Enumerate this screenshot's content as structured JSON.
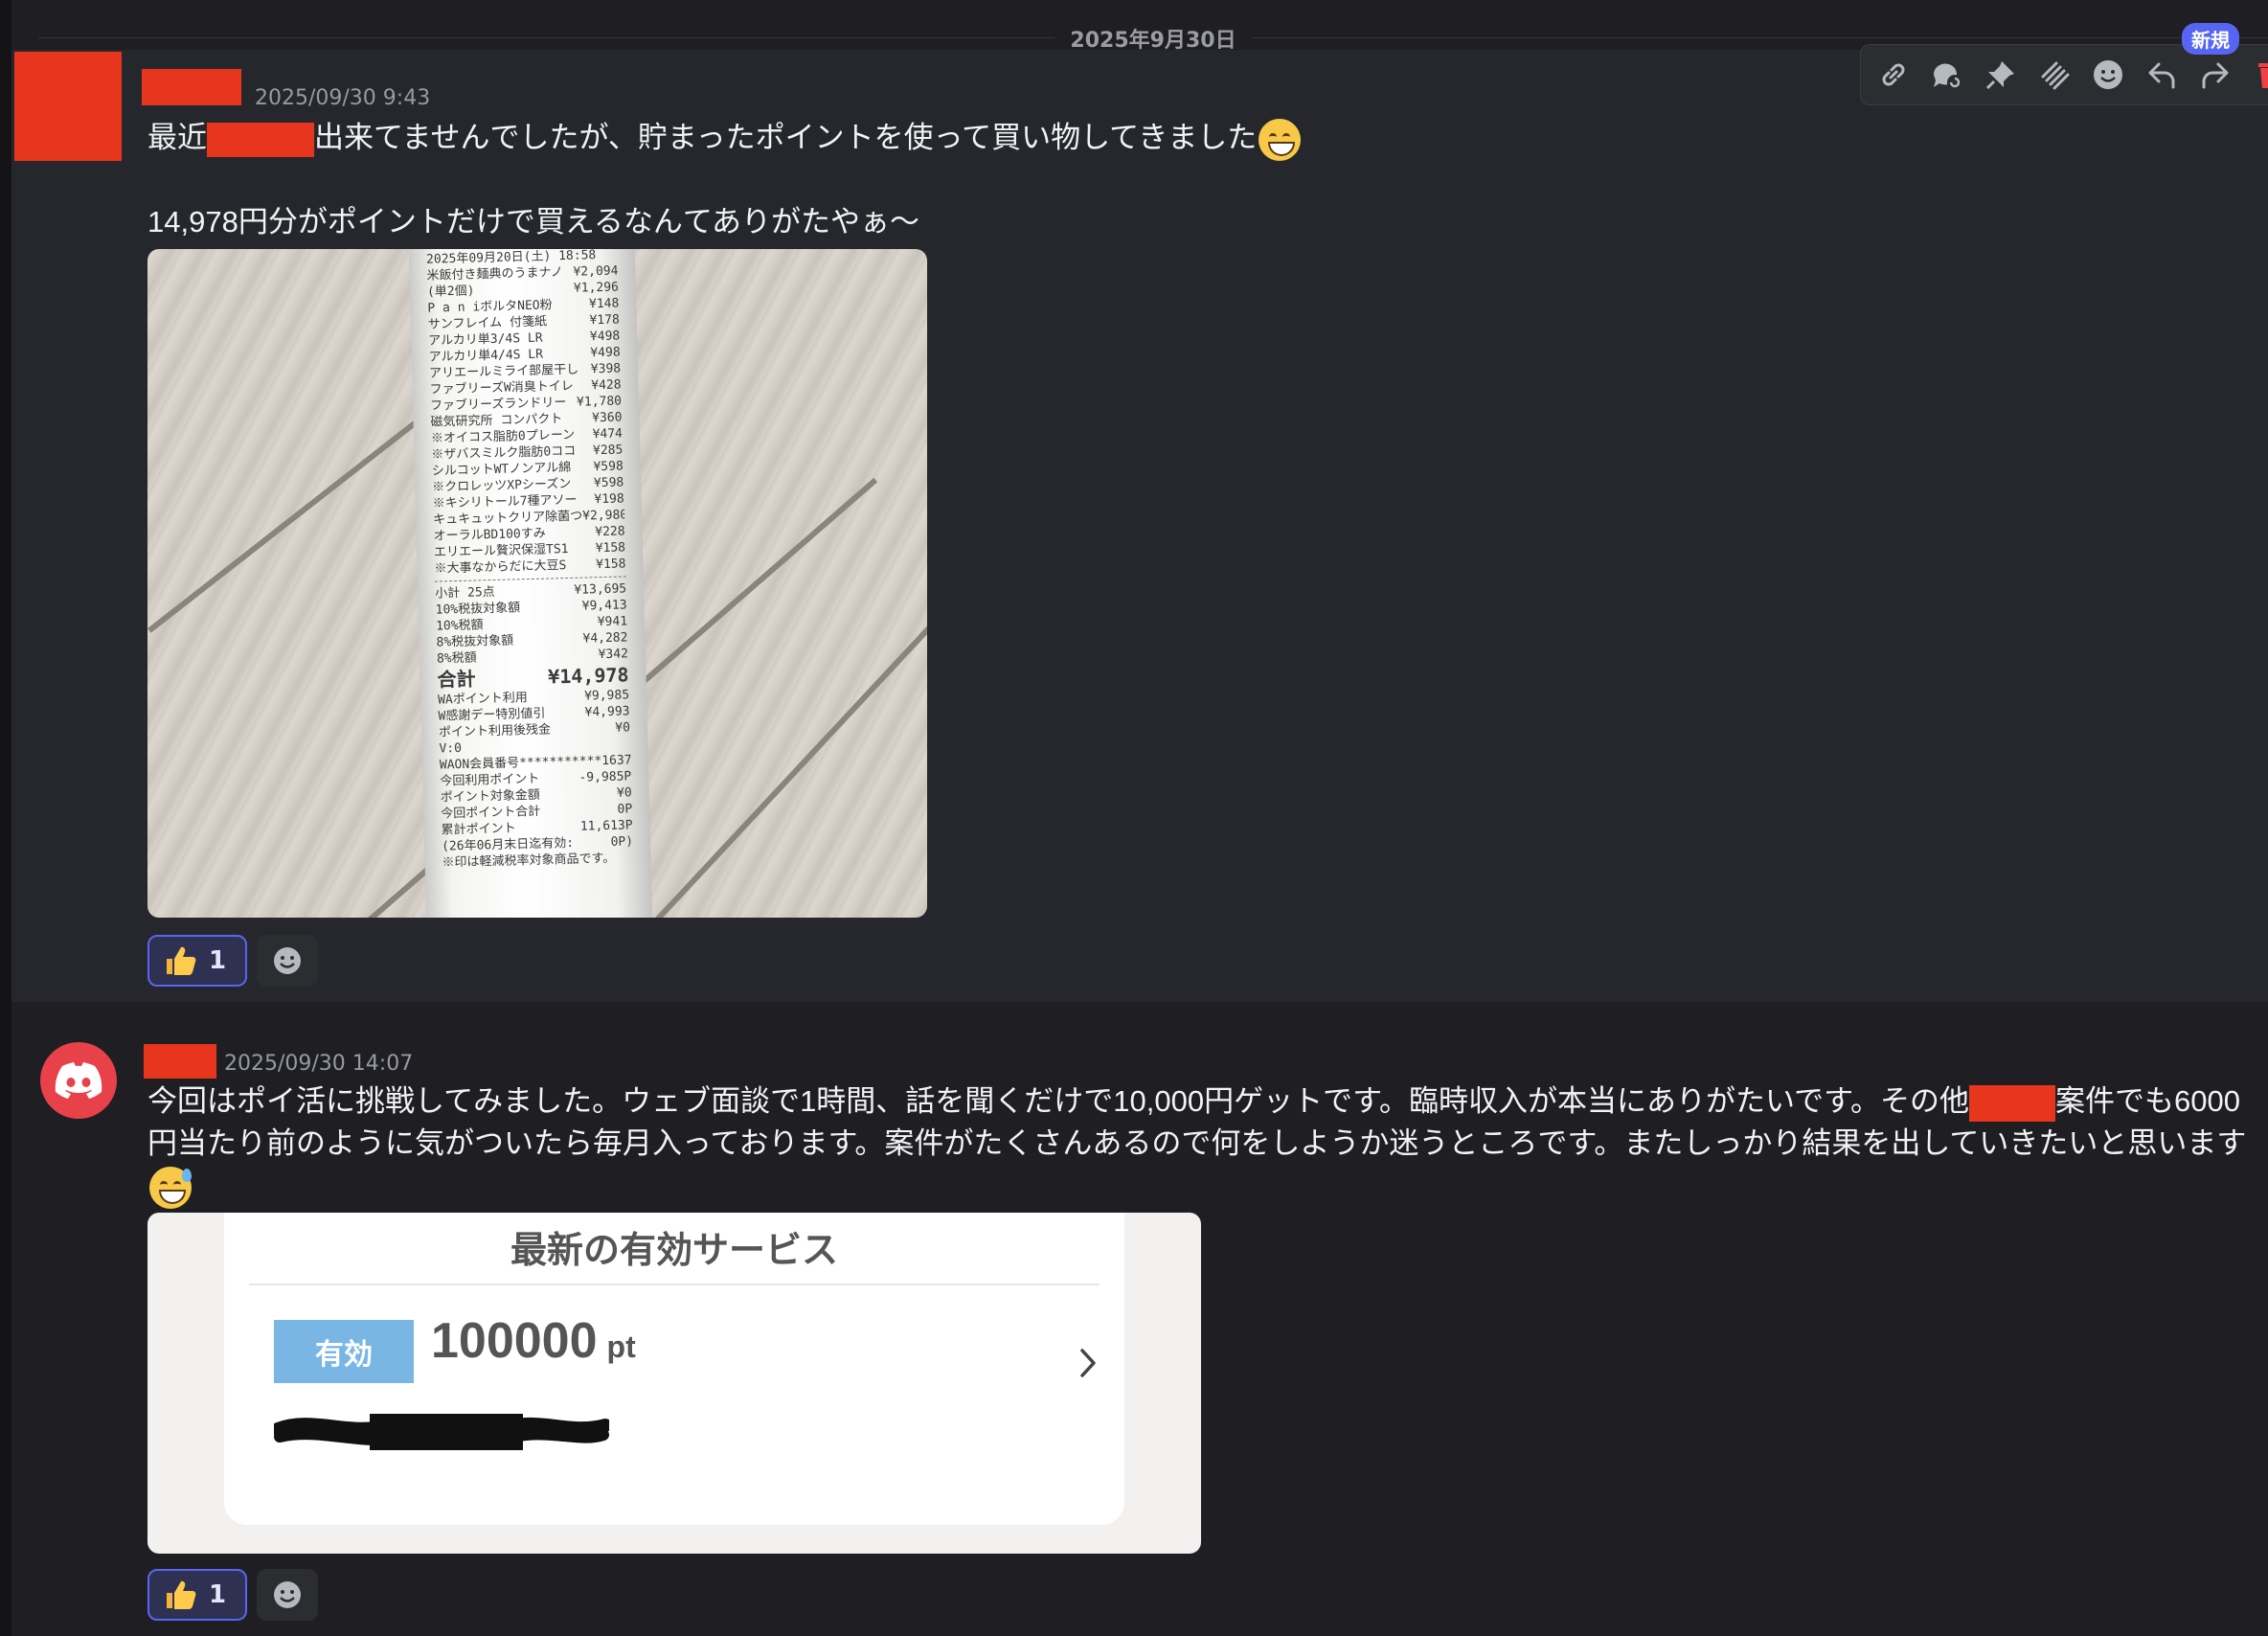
{
  "date_divider": "2025年9月30日",
  "toolbar": {
    "new_badge": "新規",
    "icons": [
      "link-icon",
      "thread-icon",
      "pin-icon",
      "mark-icon",
      "emoji-icon",
      "reply-icon",
      "forward-icon",
      "delete-icon"
    ]
  },
  "messages": [
    {
      "timestamp": "2025/09/30 9:43",
      "line1_before": "最近",
      "line1_after": "出来てませんでしたが、貯まったポイントを使って買い物してきました",
      "line2": "14,978円分がポイントだけで買えるなんてありがたやぁ〜",
      "receipt": {
        "header": "2025年09月20日(土) 18:58",
        "items": [
          [
            "米飯付き麺典のうまナノ",
            "¥2,094"
          ],
          [
            "(単2個)",
            "¥1,296"
          ],
          [
            "P a n iボルタNEO粉",
            "¥148"
          ],
          [
            "サンフレイム 付箋紙",
            "¥178"
          ],
          [
            "アルカリ単3/4S LR",
            "¥498"
          ],
          [
            "アルカリ単4/4S LR",
            "¥498"
          ],
          [
            "アリエールミライ部屋干し",
            "¥398"
          ],
          [
            "ファブリーズW消臭トイレ",
            "¥428"
          ],
          [
            "ファブリーズランドリー",
            "¥1,780"
          ],
          [
            "磁気研究所 コンパクト",
            "¥360"
          ],
          [
            "※オイコス脂肪0プレーン",
            "¥474"
          ],
          [
            "※ザバスミルク脂肪0ココ",
            "¥285"
          ],
          [
            "シルコットWTノンアル綿",
            "¥598"
          ],
          [
            "※クロレッツXPシーズン",
            "¥598"
          ],
          [
            "※キシリトール7種アソー",
            "¥198"
          ],
          [
            "キュキュットクリア除菌つ",
            "¥2,980"
          ],
          [
            "オーラルBD100すみ",
            "¥228"
          ],
          [
            "エリエール贅沢保湿TS1",
            "¥158"
          ],
          [
            "※大事なからだに大豆S",
            "¥158"
          ]
        ],
        "totals": [
          [
            "小計 25点",
            "¥13,695"
          ],
          [
            "10%税抜対象額",
            "¥9,413"
          ],
          [
            "10%税額",
            "¥941"
          ],
          [
            "8%税抜対象額",
            "¥4,282"
          ],
          [
            "8%税額",
            "¥342"
          ]
        ],
        "grand_total_label": "合計",
        "grand_total": "¥14,978",
        "after": [
          [
            "WAポイント利用",
            "¥9,985"
          ],
          [
            "W感謝デー特別値引",
            "¥4,993"
          ],
          [
            "ポイント利用後残金",
            "¥0"
          ],
          [
            "V:0",
            ""
          ],
          [
            "WAON会員番号",
            "***********1637"
          ],
          [
            "今回利用ポイント",
            "-9,985P"
          ],
          [
            "ポイント対象金額",
            "¥0"
          ],
          [
            "今回ポイント合計",
            "0P"
          ],
          [
            "累計ポイント",
            "11,613P"
          ],
          [
            "(26年06月末日迄有効:",
            "0P)"
          ],
          [
            "※印は軽減税率対象商品です。",
            ""
          ]
        ]
      },
      "reaction_count": "1"
    },
    {
      "timestamp": "2025/09/30 14:07",
      "text_part1": "今回はポイ活に挑戦してみました。ウェブ面談で1時間、話を聞くだけで10,000円ゲットです。臨時収入が本当にありがたいです。その他",
      "text_part2": "案件でも6000円当たり前のように気がついたら毎月入っております。案件がたくさんあるので何をしようか迷うところです。またしっかり結果を出していきたいと思います",
      "service_card": {
        "title": "最新の有効サービス",
        "badge": "有効",
        "points": "100000",
        "unit": "pt"
      },
      "reaction_count": "1"
    }
  ]
}
